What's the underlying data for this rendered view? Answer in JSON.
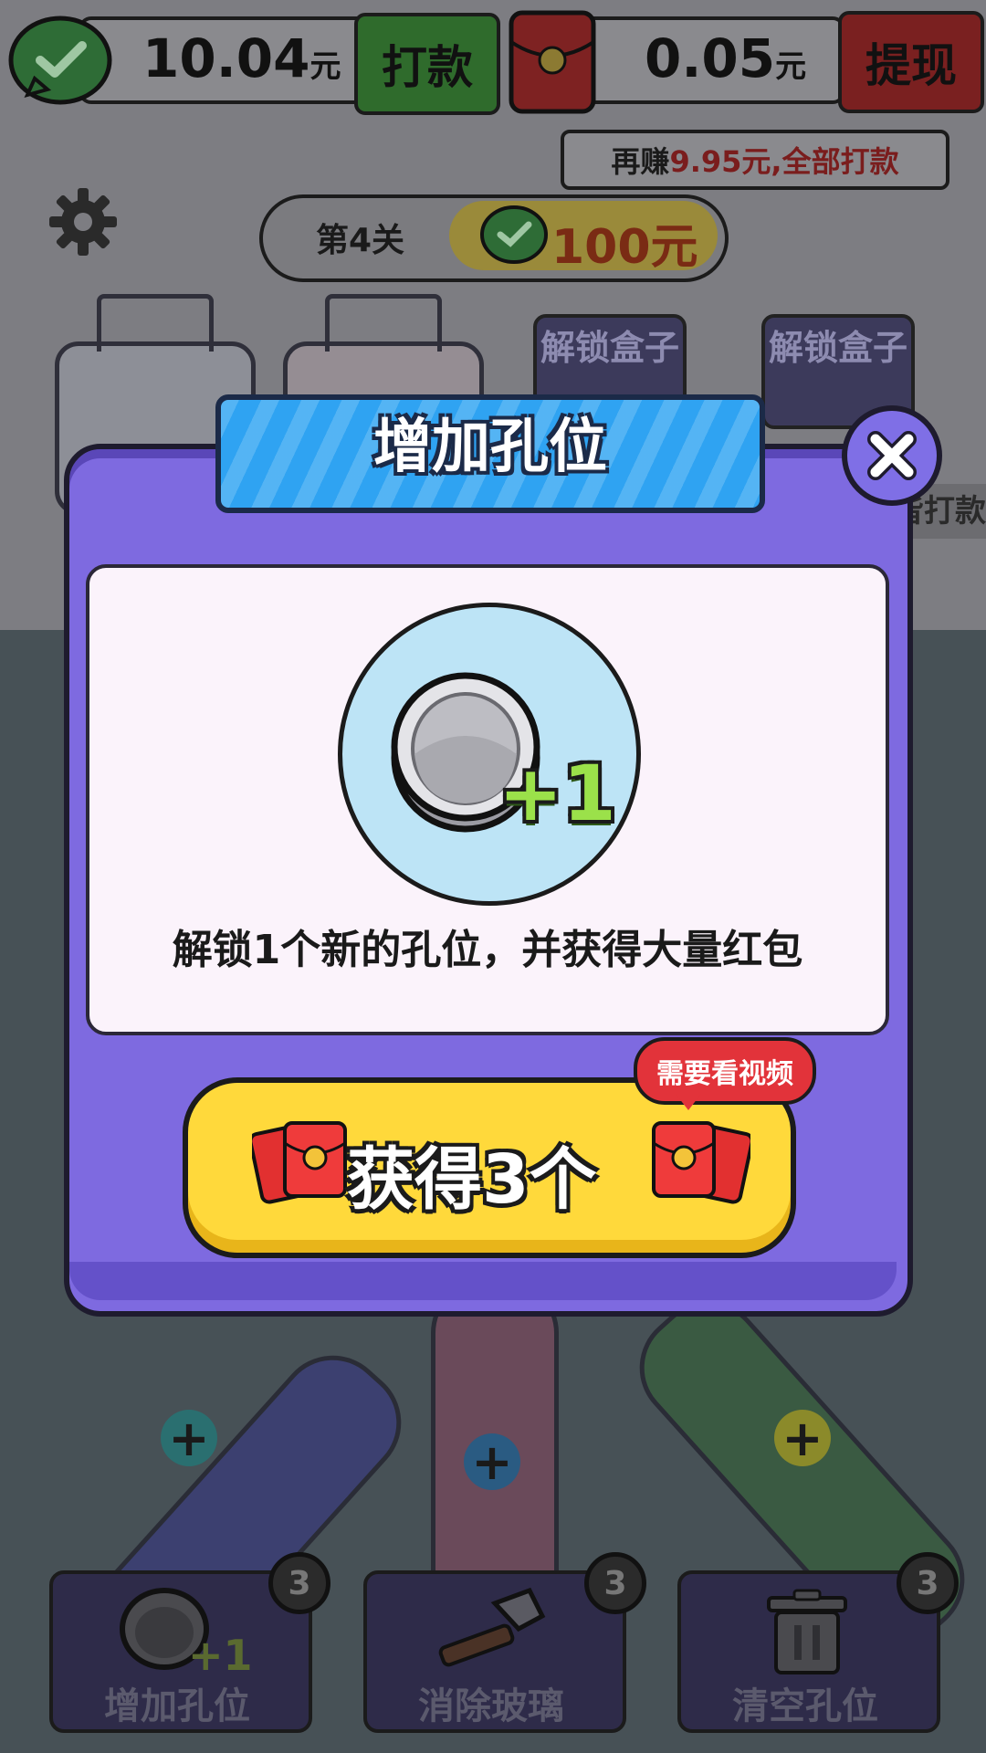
{
  "hud": {
    "cash_amount": "10.04",
    "cash_unit": "元",
    "payout_label": "打款",
    "redpacket_amount": "0.05",
    "redpacket_unit": "元",
    "withdraw_label": "提现",
    "earn_more_prefix": "再赚",
    "earn_more_amount": "9.95元",
    "earn_more_suffix": ",全部打款"
  },
  "level": {
    "label": "第4关",
    "reward": "100元"
  },
  "background": {
    "unlock_box_1": "解锁盒子",
    "unlock_box_2": "解锁盒子",
    "side_text": "皆打款"
  },
  "dialog": {
    "title": "增加孔位",
    "badge_plus": "+1",
    "description": "解锁1个新的孔位，并获得大量红包",
    "get_button_label": "获得3个",
    "video_tag": "需要看视频"
  },
  "tools": [
    {
      "label": "增加孔位",
      "count": "3",
      "badge_plus": "+1"
    },
    {
      "label": "消除玻璃",
      "count": "3"
    },
    {
      "label": "清空孔位",
      "count": "3"
    }
  ],
  "colors": {
    "dialog_purple": "#7e6ae0",
    "banner_blue": "#2fa3f2",
    "button_yellow": "#ffd93b",
    "plus_green": "#9be14a",
    "red_tag": "#e2333a"
  }
}
